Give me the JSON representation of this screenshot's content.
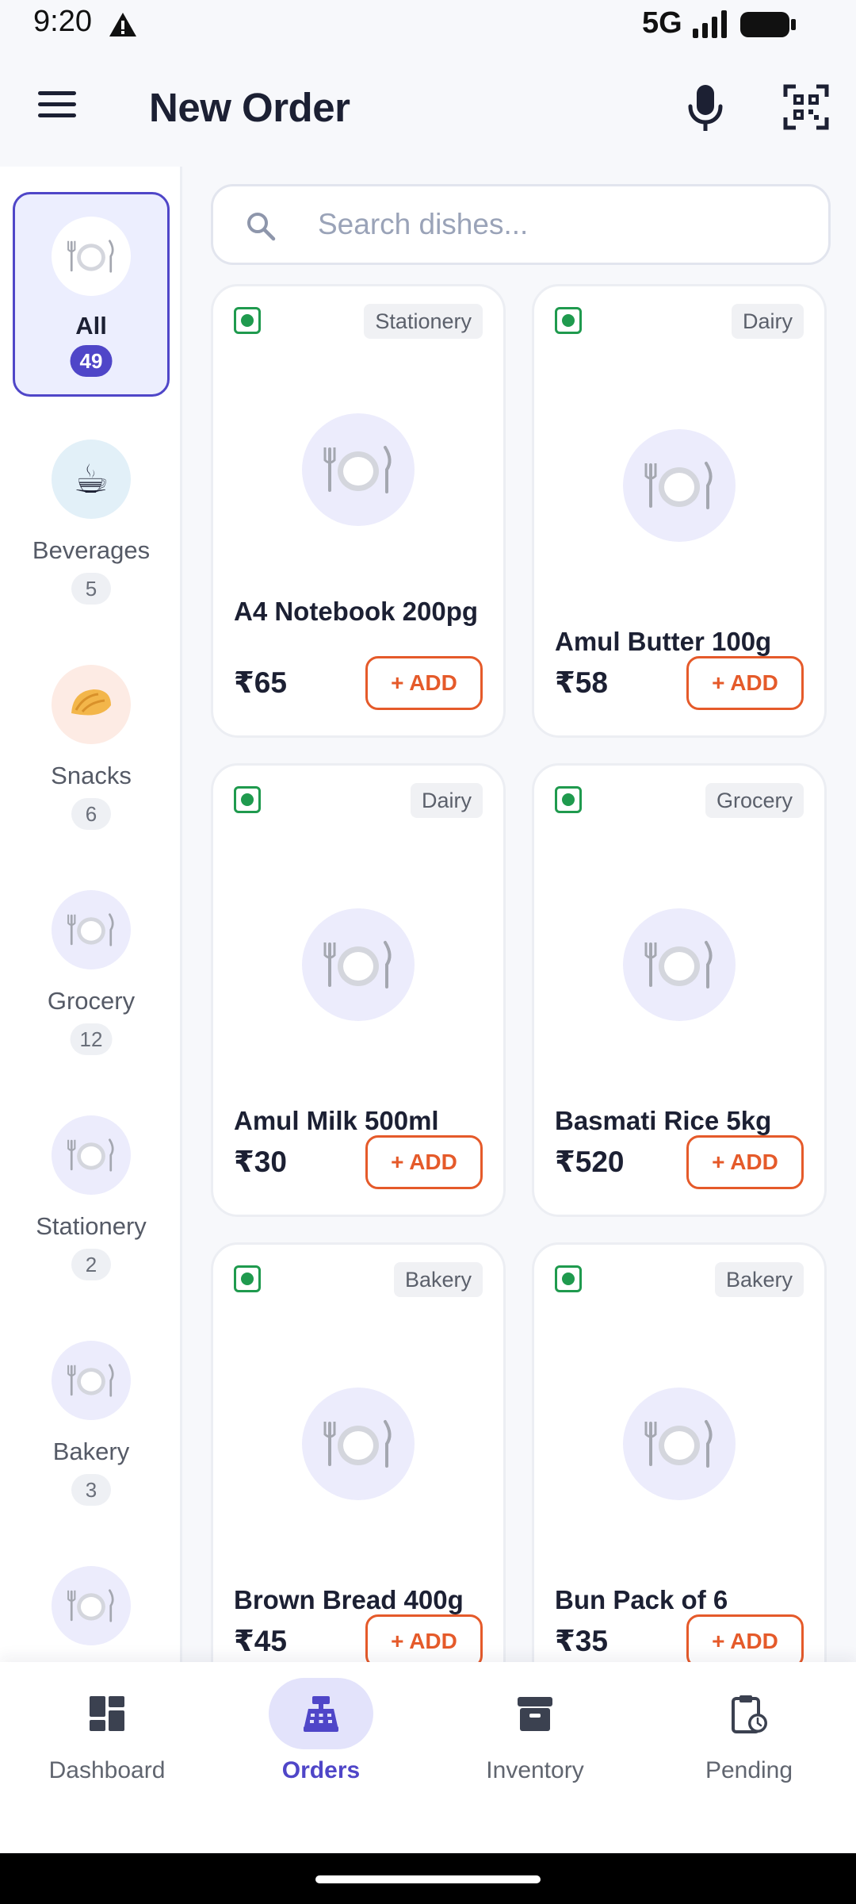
{
  "status_bar": {
    "time": "9:20",
    "network": "5G"
  },
  "app_bar": {
    "title": "New Order"
  },
  "search": {
    "placeholder": "Search dishes..."
  },
  "sidebar": {
    "items": [
      {
        "label": "All",
        "count": "49",
        "icon": "plate",
        "active": true
      },
      {
        "label": "Beverages",
        "count": "5",
        "icon": "coffee"
      },
      {
        "label": "Snacks",
        "count": "6",
        "icon": "dumpling"
      },
      {
        "label": "Grocery",
        "count": "12",
        "icon": "plate"
      },
      {
        "label": "Stationery",
        "count": "2",
        "icon": "plate"
      },
      {
        "label": "Bakery",
        "count": "3",
        "icon": "plate"
      },
      {
        "icon": "plate"
      }
    ]
  },
  "products": [
    {
      "name": "A4 Notebook 200pg",
      "category": "Stationery",
      "price": "₹65",
      "add_label": "+ ADD"
    },
    {
      "name": "Amul Butter 100g",
      "category": "Dairy",
      "price": "₹58",
      "add_label": "+ ADD"
    },
    {
      "name": "Amul Milk 500ml",
      "category": "Dairy",
      "price": "₹30",
      "add_label": "+ ADD"
    },
    {
      "name": "Basmati Rice 5kg",
      "category": "Grocery",
      "price": "₹520",
      "add_label": "+ ADD"
    },
    {
      "name": "Brown Bread 400g",
      "category": "Bakery",
      "price": "₹45",
      "add_label": "+ ADD"
    },
    {
      "name": "Bun Pack of 6",
      "category": "Bakery",
      "price": "₹35",
      "add_label": "+ ADD"
    }
  ],
  "bottom_nav": {
    "items": [
      {
        "label": "Dashboard",
        "icon": "dashboard-icon"
      },
      {
        "label": "Orders",
        "icon": "cash-register-icon",
        "active": true
      },
      {
        "label": "Inventory",
        "icon": "archive-box-icon"
      },
      {
        "label": "Pending",
        "icon": "clipboard-clock-icon"
      }
    ]
  },
  "colors": {
    "primary": "#4f46c8",
    "accent": "#e55a2a",
    "veg": "#1f9a4e",
    "dish_circle": "#ececfc",
    "background": "#f7f8fb"
  }
}
